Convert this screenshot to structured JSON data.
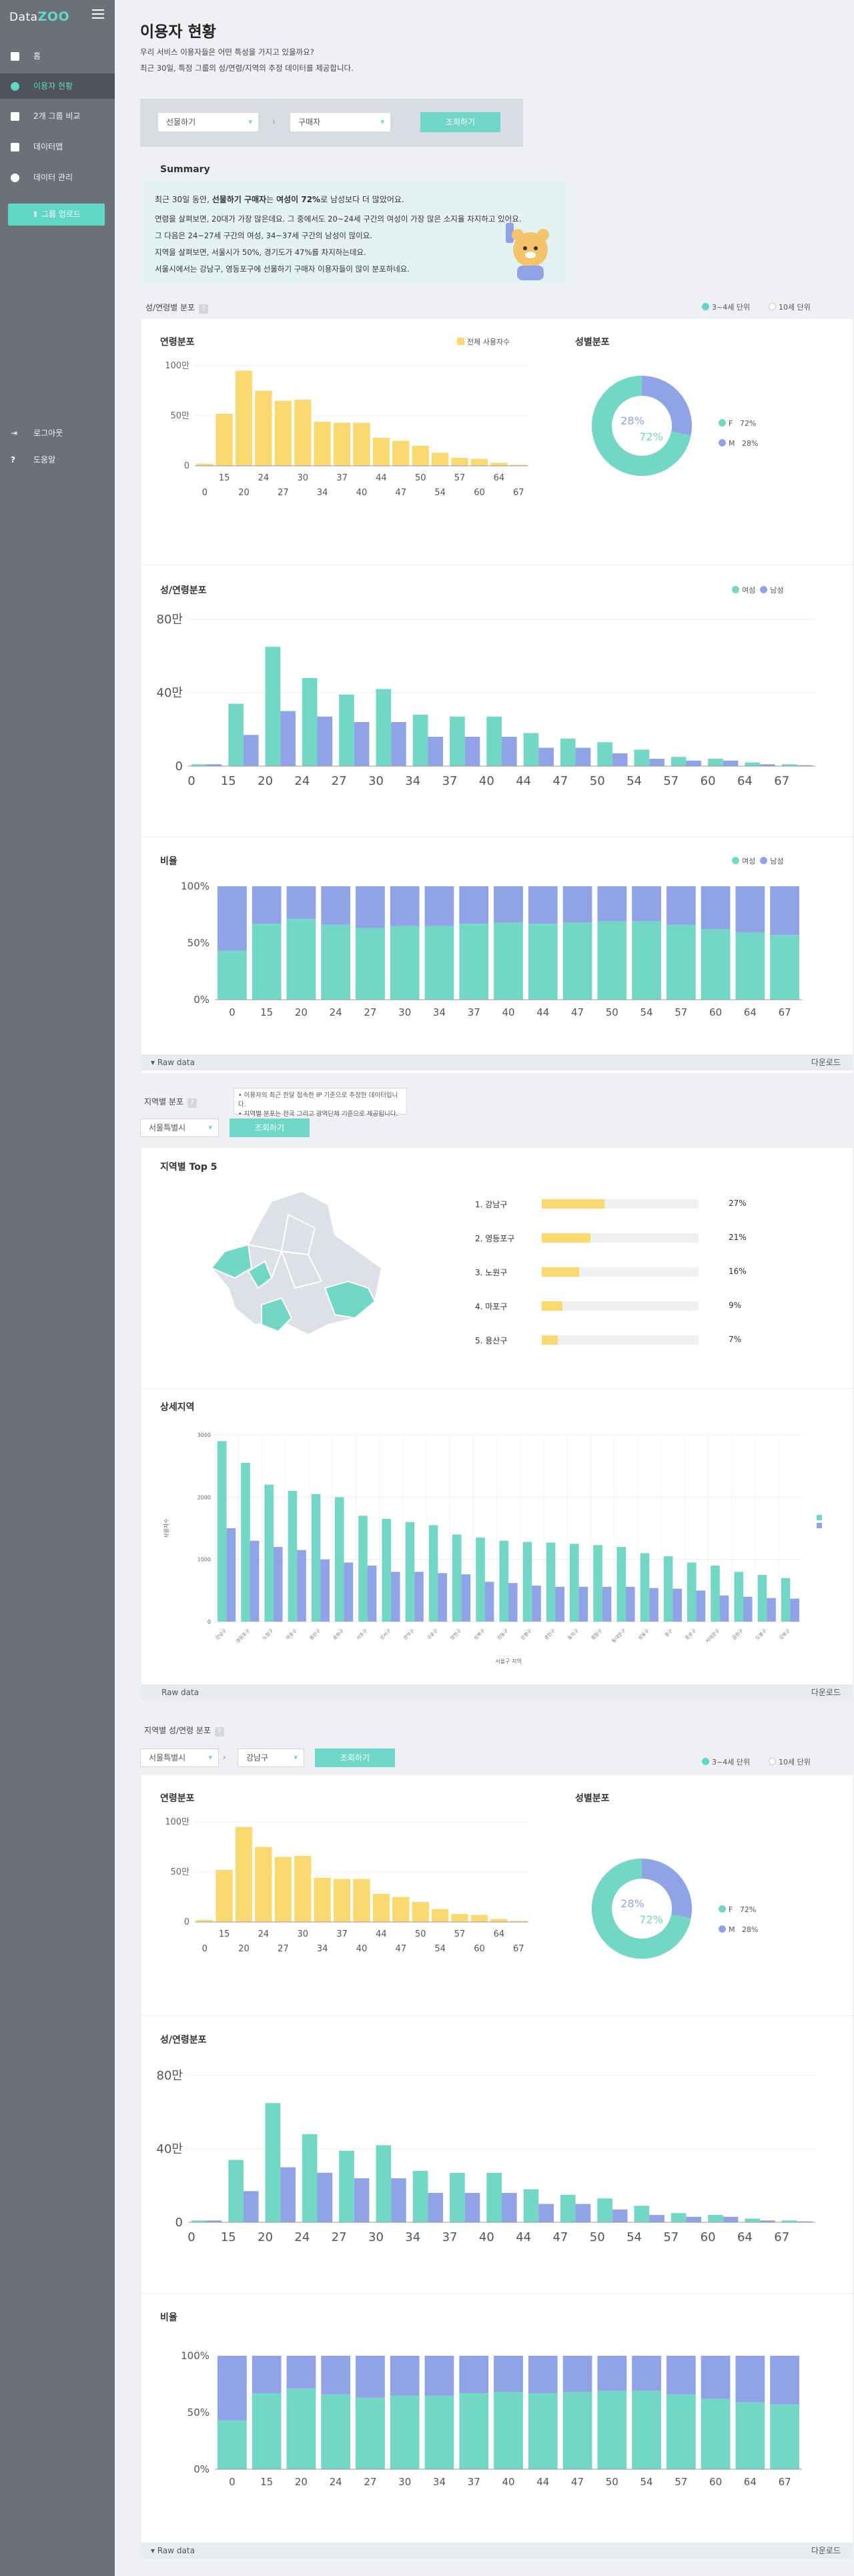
{
  "sidebar": {
    "logo_data": "Data",
    "logo_zoo": "ZOO",
    "items": [
      {
        "label": "홈",
        "icon": "home-icon"
      },
      {
        "label": "이용자 현황",
        "icon": "user-icon"
      },
      {
        "label": "2개 그룹 비교",
        "icon": "compare-icon"
      },
      {
        "label": "데이터맵",
        "icon": "map-icon"
      },
      {
        "label": "데이터 관리",
        "icon": "database-icon"
      }
    ],
    "upload": "그룹 업로드",
    "logout": "로그아웃",
    "help": "도움말"
  },
  "page": {
    "title": "이용자 현황",
    "subtitle1": "우리 서비스 이용자들은 어떤 특성을 가지고 있을까요?",
    "subtitle2": "최근 30일, 특정 그룹의 성/연령/지역의 추정 데이터를 제공합니다."
  },
  "filter": {
    "select1": "선물하기",
    "select2": "구매자",
    "button": "조회하기"
  },
  "summary": {
    "heading": "Summary",
    "line1a": "최근 30일 동안, ",
    "line1b": "선물하기 구매자",
    "line1c": "는 ",
    "line1d": "여성이 72%",
    "line1e": "로 남성보다 더 많았어요.",
    "line2": "연령을 살펴보면, 20대가 가장 많은데요. 그 중에서도 20~24세 구간의 여성이 가장 많은 소지율 차지하고 있어요.",
    "line3": "그 다음은 24~27세 구간의 여성, 34~37세 구간의 남성이 많이요.",
    "line4": "지역을 살펴보면, 서울시가 50%, 경기도가 47%를 차지하는데요.",
    "line5": "서울시에서는 강남구, 영등포구에 선물하기 구매자 이용자들이 많이 분포하네요."
  },
  "section1": {
    "label": "성/연령별 분포",
    "unit3": "3~4세 단위",
    "unit10": "10세 단위",
    "age_title": "연령분포",
    "age_legend": "전체 사용자수",
    "gender_title": "성별분포",
    "f_label": "F",
    "f_pct": "72%",
    "m_label": "M",
    "m_pct": "28%",
    "donut_m": "28%",
    "donut_f": "72%",
    "sexage_title": "성/연령분포",
    "female": "여성",
    "male": "남성",
    "ratio_title": "비율",
    "raw": "Raw data",
    "download": "다운로드"
  },
  "region": {
    "label": "지역별 분포",
    "note1": "• 이용자의 최근 한달 접속한 IP 기준으로 추정한 데이터입니다.",
    "note2": "• 지역별 분포는 전국 그리고 광역단체 기준으로 제공됩니다.",
    "select": "서울특별시",
    "button": "조회하기",
    "top5_title": "지역별 Top 5",
    "top5": [
      {
        "rank": "1. 강남구",
        "pct": "27%",
        "value": 0.27
      },
      {
        "rank": "2. 영등포구",
        "pct": "21%",
        "value": 0.21
      },
      {
        "rank": "3. 노원구",
        "pct": "16%",
        "value": 0.16
      },
      {
        "rank": "4. 마포구",
        "pct": "9%",
        "value": 0.09
      },
      {
        "rank": "5. 용산구",
        "pct": "7%",
        "value": 0.07
      }
    ],
    "detail_title": "상세지역",
    "ylabel": "사용자수",
    "xlabel": "서울구 지역",
    "raw": "Raw data",
    "download": "다운로드"
  },
  "section3": {
    "label": "지역별 성/연령 분포",
    "select1": "서울특별시",
    "select2": "강남구",
    "button": "조회하기",
    "unit3": "3~4세 단위",
    "unit10": "10세 단위",
    "age_title": "연령분포",
    "gender_title": "성별분포",
    "f_label": "F",
    "f_pct": "72%",
    "m_label": "M",
    "m_pct": "28%",
    "donut_m": "28%",
    "donut_f": "72%",
    "sexage_title": "성/연령분포",
    "ratio_title": "비율",
    "raw": "Raw data",
    "download": "다운로드"
  },
  "colors": {
    "teal": "#72d7c4",
    "purple": "#8fa3e6",
    "yellow": "#fbd971"
  },
  "chart_data": [
    {
      "type": "bar",
      "title": "연령분포",
      "categories": [
        "0",
        "15",
        "20",
        "24",
        "27",
        "30",
        "34",
        "37",
        "40",
        "44",
        "47",
        "50",
        "54",
        "57",
        "60",
        "64",
        "67"
      ],
      "series": [
        {
          "name": "전체 사용자수",
          "values": [
            2,
            52,
            95,
            75,
            65,
            66,
            44,
            43,
            43,
            28,
            25,
            20,
            13,
            8,
            7,
            3,
            1
          ]
        }
      ],
      "yticks": [
        "0",
        "50만",
        "100만"
      ],
      "ylim": [
        0,
        100
      ]
    },
    {
      "type": "pie",
      "title": "성별분포",
      "categories": [
        "F",
        "M"
      ],
      "values": [
        72,
        28
      ]
    },
    {
      "type": "bar",
      "title": "성/연령분포",
      "categories": [
        "0",
        "15",
        "20",
        "24",
        "27",
        "30",
        "34",
        "37",
        "40",
        "44",
        "47",
        "50",
        "54",
        "57",
        "60",
        "64",
        "67"
      ],
      "series": [
        {
          "name": "여성",
          "values": [
            1,
            34,
            65,
            48,
            39,
            42,
            28,
            27,
            27,
            18,
            15,
            13,
            9,
            5,
            4,
            2,
            1
          ]
        },
        {
          "name": "남성",
          "values": [
            1,
            17,
            30,
            27,
            24,
            24,
            16,
            16,
            16,
            10,
            10,
            7,
            4,
            3,
            3,
            1,
            0.5
          ]
        }
      ],
      "yticks": [
        "0",
        "40만",
        "80만"
      ],
      "ylim": [
        0,
        80
      ]
    },
    {
      "type": "bar",
      "title": "비율",
      "categories": [
        "0",
        "15",
        "20",
        "24",
        "27",
        "30",
        "34",
        "37",
        "40",
        "44",
        "47",
        "50",
        "54",
        "57",
        "60",
        "64",
        "67"
      ],
      "series": [
        {
          "name": "여성",
          "values": [
            43,
            67,
            71,
            66,
            63,
            65,
            65,
            67,
            68,
            67,
            68,
            69,
            69,
            66,
            62,
            59,
            57
          ]
        },
        {
          "name": "남성",
          "values": [
            57,
            33,
            29,
            34,
            37,
            35,
            35,
            33,
            32,
            33,
            32,
            31,
            31,
            34,
            38,
            41,
            43
          ]
        }
      ],
      "yticks": [
        "0%",
        "50%",
        "100%"
      ],
      "ylim": [
        0,
        100
      ]
    },
    {
      "type": "bar",
      "title": "상세지역",
      "categories": [
        "강남구",
        "영등포구",
        "노원구",
        "마포구",
        "용산구",
        "송파구",
        "서초구",
        "강서구",
        "관악구",
        "구로구",
        "양천구",
        "성북구",
        "강동구",
        "은평구",
        "광진구",
        "동작구",
        "중랑구",
        "동대문구",
        "성동구",
        "중구",
        "종로구",
        "서대문구",
        "금천구",
        "도봉구",
        "강북구"
      ],
      "series": [
        {
          "name": "여성",
          "values": [
            2900,
            2550,
            2200,
            2100,
            2050,
            2000,
            1700,
            1650,
            1600,
            1550,
            1400,
            1350,
            1300,
            1280,
            1270,
            1250,
            1230,
            1200,
            1100,
            1050,
            950,
            900,
            800,
            750,
            700
          ]
        },
        {
          "name": "남성",
          "values": [
            1500,
            1300,
            1200,
            1150,
            1000,
            950,
            900,
            800,
            800,
            780,
            760,
            640,
            620,
            580,
            560,
            560,
            560,
            560,
            540,
            530,
            500,
            420,
            400,
            380,
            370
          ]
        }
      ],
      "yticks": [
        "0",
        "1000",
        "2000",
        "3000"
      ],
      "ylim": [
        0,
        3000
      ]
    }
  ]
}
